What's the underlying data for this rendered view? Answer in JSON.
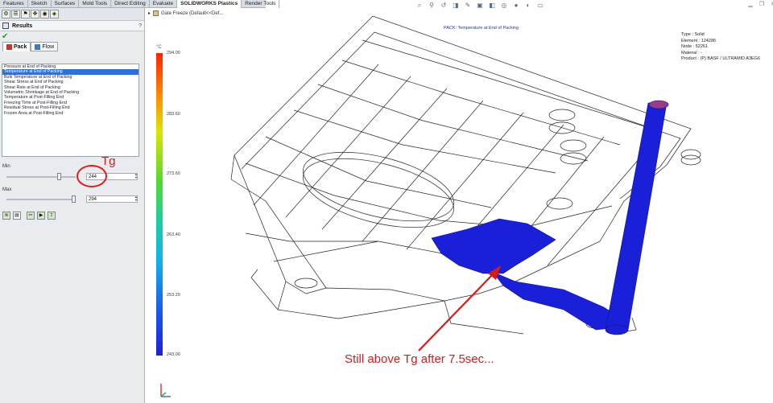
{
  "command_tabs": [
    "Features",
    "Sketch",
    "Surfaces",
    "Mold Tools",
    "Direct Editing",
    "Evaluate",
    "SOLIDWORKS Plastics",
    "Render Tools"
  ],
  "active_command_tab": "SOLIDWORKS Plastics",
  "panel": {
    "title": "Results",
    "help_glyph": "?",
    "tabs": [
      "Pack",
      "Flow"
    ],
    "results": [
      "Pressure at End of Packing",
      "Temperature at End of Packing",
      "Bulk Temperature at End of Packing",
      "Shear Stress at End of Packing",
      "Shear Rate at End of Packing",
      "Volumetric Shrinkage at End of Packing",
      "Temperature at Post-Filling End",
      "Freezing Time at Post-Filling End",
      "Residual Stress at Post-Filling End",
      "Frozen Area at Post-Filling End"
    ],
    "selected_index": 1,
    "min_label": "Min",
    "min_value": "244",
    "max_label": "Max",
    "max_value": "294",
    "min_slider_fraction": 0.75,
    "max_slider_fraction": 0.97
  },
  "annotation_tg": "Tg",
  "tree_label": "Gate Freeze  (Default<<Def...",
  "plot_title": "PACK: Temperature at End of Packing",
  "info": {
    "type": "Type : Solid",
    "element": "Element : 124286",
    "node": "Node : 52261",
    "material": "Material : -",
    "product": "Product :  (P) BASF / ULTRAMID A3EG6"
  },
  "colorbar": {
    "unit": "°C",
    "ticks": [
      "294.00",
      "283.60",
      "273.60",
      "263.40",
      "253.20",
      "243.00"
    ],
    "colors": [
      "#ff2200",
      "#ff8a00",
      "#d9e600",
      "#57d832",
      "#1ecf9c",
      "#10b6e8",
      "#1b5ff0",
      "#1b1fd6"
    ]
  },
  "callout": "Still above Tg after 7.5sec..."
}
